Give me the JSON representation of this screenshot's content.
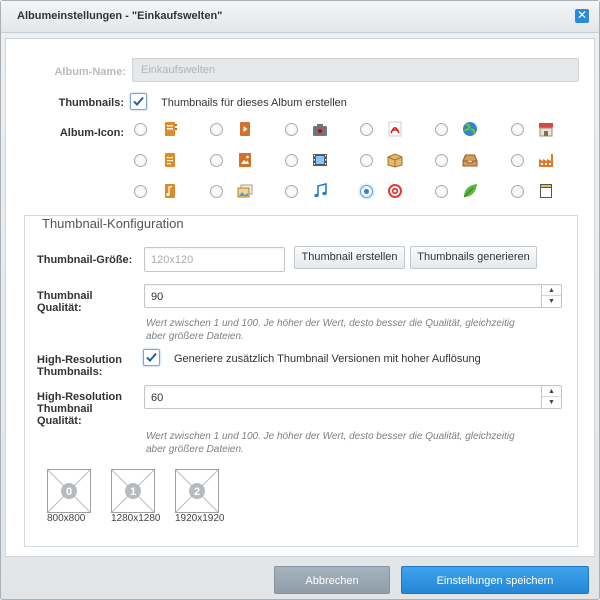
{
  "dialog": {
    "title": "Albumeinstellungen - \"Einkaufswelten\"",
    "close_glyph": "✕"
  },
  "album": {
    "name_label": "Album-Name:",
    "name_value": "Einkaufswelten",
    "thumbnails_label": "Thumbnails:",
    "thumbnails_checkbox_text": "Thumbnails für dieses Album erstellen",
    "thumbnails_checked": true,
    "icon_label": "Album-Icon:",
    "icons": [
      "notebook-icon",
      "video-file-icon",
      "camera-icon",
      "pdf-icon",
      "globe-icon",
      "shop-icon",
      "document-icon",
      "image-file-icon",
      "film-icon",
      "package-icon",
      "inbox-icon",
      "factory-icon",
      "music-file-icon",
      "images-icon",
      "music-note-icon",
      "target-icon",
      "leaf-icon",
      "blank-page-icon"
    ],
    "selected_icon": "target-icon"
  },
  "thumbnail_config": {
    "legend": "Thumbnail-Konfiguration",
    "size_label": "Thumbnail-Größe:",
    "size_placeholder": "120x120",
    "create_button": "Thumbnail erstellen",
    "generate_button": "Thumbnails generieren",
    "quality_label_1": "Thumbnail",
    "quality_label_2": "Qualität:",
    "quality_value": "90",
    "quality_hint_1": "Wert zwischen 1 und 100. Je höher der Wert, desto besser die Qualität, gleichzeitig",
    "quality_hint_2": "aber größere Dateien.",
    "hires_label_1": "High-Resolution",
    "hires_label_2": "Thumbnails:",
    "hires_checkbox_text": "Generiere zusätzlich Thumbnail Versionen mit hoher Auflösung",
    "hires_checked": true,
    "hires_quality_label_1": "High-Resolution",
    "hires_quality_label_2": "Thumbnail",
    "hires_quality_label_3": "Qualität:",
    "hires_quality_value": "60",
    "hires_hint_1": "Wert zwischen 1 und 100. Je höher der Wert, desto besser die Qualität, gleichzeitig",
    "hires_hint_2": "aber größere Dateien.",
    "thumbnails": [
      {
        "index": "0",
        "size": "800x800"
      },
      {
        "index": "1",
        "size": "1280x1280"
      },
      {
        "index": "2",
        "size": "1920x1920"
      }
    ]
  },
  "footer": {
    "cancel_label": "Abbrechen",
    "save_label": "Einstellungen speichern"
  },
  "colors": {
    "accent": "#2a8bd8",
    "cancel": "#98a6b1"
  }
}
